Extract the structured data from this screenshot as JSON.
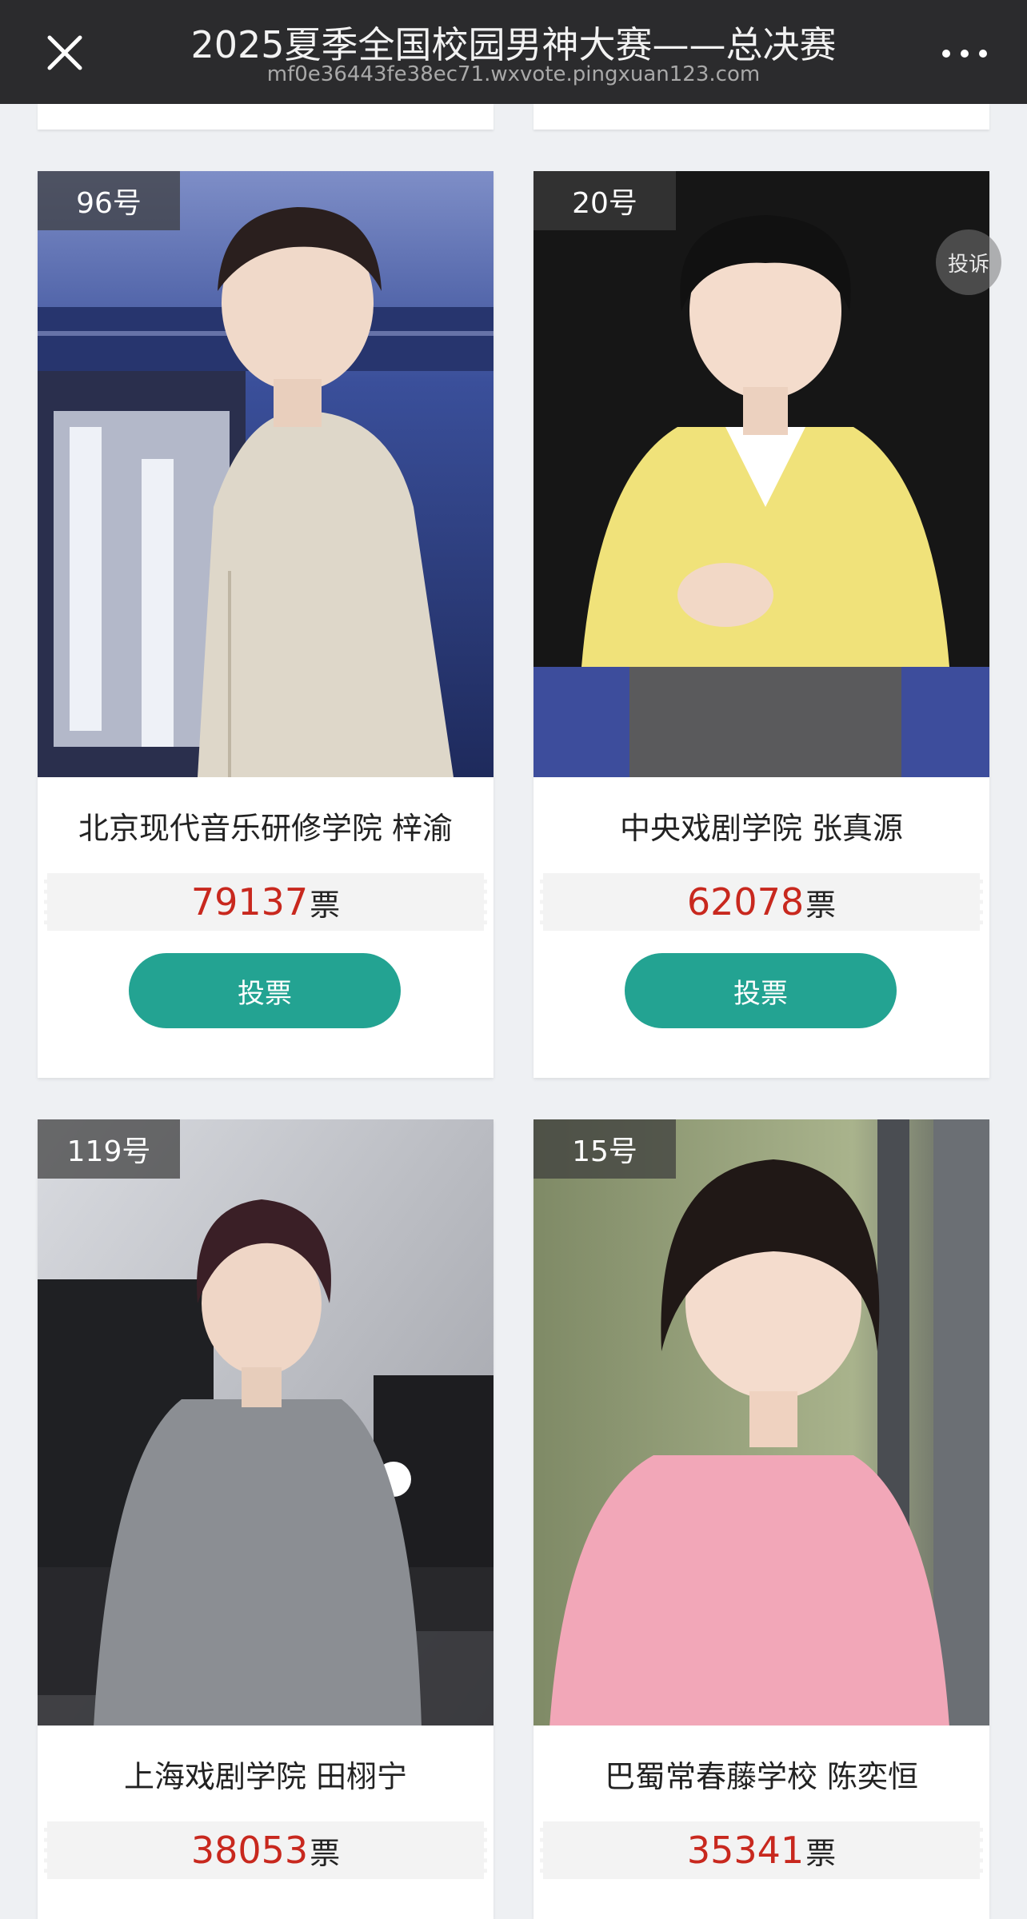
{
  "header": {
    "title": "2025夏季全国校园男神大赛——总决赛",
    "url": "mf0e36443fe38ec71.wxvote.pingxuan123.com"
  },
  "report_label": "投诉",
  "vote_unit": "票",
  "vote_button_label": "投票",
  "contestants": [
    {
      "number": "96号",
      "name": "北京现代音乐研修学院 梓渝",
      "votes": "79137"
    },
    {
      "number": "20号",
      "name": "中央戏剧学院 张真源",
      "votes": "62078"
    },
    {
      "number": "119号",
      "name": "上海戏剧学院 田栩宁",
      "votes": "38053"
    },
    {
      "number": "15号",
      "name": "巴蜀常春藤学校 陈奕恒",
      "votes": "35341"
    }
  ],
  "colors": {
    "accent": "#23a392",
    "vote_count": "#c8281e",
    "topbar": "#2b2b2d"
  }
}
